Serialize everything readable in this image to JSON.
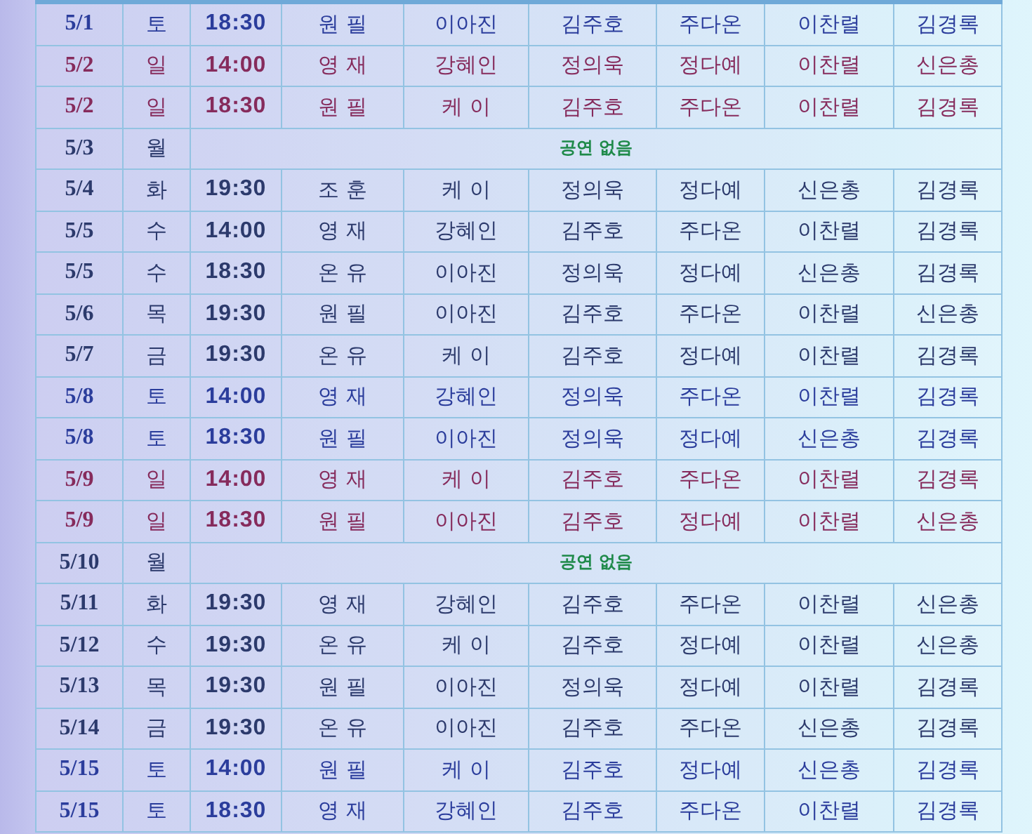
{
  "schedule": {
    "rows": [
      {
        "kind": "saturday",
        "date": "5/1",
        "day": "토",
        "time": "18:30",
        "cast": [
          "원 필",
          "이아진",
          "김주호",
          "주다온",
          "이찬렬",
          "김경록"
        ]
      },
      {
        "kind": "sunday",
        "date": "5/2",
        "day": "일",
        "time": "14:00",
        "cast": [
          "영 재",
          "강혜인",
          "정의욱",
          "정다예",
          "이찬렬",
          "신은총"
        ]
      },
      {
        "kind": "sunday",
        "date": "5/2",
        "day": "일",
        "time": "18:30",
        "cast": [
          "원 필",
          "케 이",
          "김주호",
          "주다온",
          "이찬렬",
          "김경록"
        ]
      },
      {
        "kind": "off",
        "date": "5/3",
        "day": "월",
        "note": "공연 없음"
      },
      {
        "kind": "weekday",
        "date": "5/4",
        "day": "화",
        "time": "19:30",
        "cast": [
          "조 훈",
          "케 이",
          "정의욱",
          "정다예",
          "신은총",
          "김경록"
        ]
      },
      {
        "kind": "weekday",
        "date": "5/5",
        "day": "수",
        "time": "14:00",
        "cast": [
          "영 재",
          "강혜인",
          "김주호",
          "주다온",
          "이찬렬",
          "김경록"
        ]
      },
      {
        "kind": "weekday",
        "date": "5/5",
        "day": "수",
        "time": "18:30",
        "cast": [
          "온 유",
          "이아진",
          "정의욱",
          "정다예",
          "신은총",
          "김경록"
        ]
      },
      {
        "kind": "weekday",
        "date": "5/6",
        "day": "목",
        "time": "19:30",
        "cast": [
          "원 필",
          "이아진",
          "김주호",
          "주다온",
          "이찬렬",
          "신은총"
        ]
      },
      {
        "kind": "weekday",
        "date": "5/7",
        "day": "금",
        "time": "19:30",
        "cast": [
          "온 유",
          "케 이",
          "김주호",
          "정다예",
          "이찬렬",
          "김경록"
        ]
      },
      {
        "kind": "saturday",
        "date": "5/8",
        "day": "토",
        "time": "14:00",
        "cast": [
          "영 재",
          "강혜인",
          "정의욱",
          "주다온",
          "이찬렬",
          "김경록"
        ]
      },
      {
        "kind": "saturday",
        "date": "5/8",
        "day": "토",
        "time": "18:30",
        "cast": [
          "원 필",
          "이아진",
          "정의욱",
          "정다예",
          "신은총",
          "김경록"
        ]
      },
      {
        "kind": "sunday",
        "date": "5/9",
        "day": "일",
        "time": "14:00",
        "cast": [
          "영 재",
          "케 이",
          "김주호",
          "주다온",
          "이찬렬",
          "김경록"
        ]
      },
      {
        "kind": "sunday",
        "date": "5/9",
        "day": "일",
        "time": "18:30",
        "cast": [
          "원 필",
          "이아진",
          "김주호",
          "정다예",
          "이찬렬",
          "신은총"
        ]
      },
      {
        "kind": "off",
        "date": "5/10",
        "day": "월",
        "note": "공연 없음"
      },
      {
        "kind": "weekday",
        "date": "5/11",
        "day": "화",
        "time": "19:30",
        "cast": [
          "영 재",
          "강혜인",
          "김주호",
          "주다온",
          "이찬렬",
          "신은총"
        ]
      },
      {
        "kind": "weekday",
        "date": "5/12",
        "day": "수",
        "time": "19:30",
        "cast": [
          "온 유",
          "케 이",
          "김주호",
          "정다예",
          "이찬렬",
          "신은총"
        ]
      },
      {
        "kind": "weekday",
        "date": "5/13",
        "day": "목",
        "time": "19:30",
        "cast": [
          "원 필",
          "이아진",
          "정의욱",
          "정다예",
          "이찬렬",
          "김경록"
        ]
      },
      {
        "kind": "weekday",
        "date": "5/14",
        "day": "금",
        "time": "19:30",
        "cast": [
          "온 유",
          "이아진",
          "김주호",
          "주다온",
          "신은총",
          "김경록"
        ]
      },
      {
        "kind": "saturday",
        "date": "5/15",
        "day": "토",
        "time": "14:00",
        "cast": [
          "원 필",
          "케 이",
          "김주호",
          "정다예",
          "신은총",
          "김경록"
        ]
      },
      {
        "kind": "saturday",
        "date": "5/15",
        "day": "토",
        "time": "18:30",
        "cast": [
          "영 재",
          "강혜인",
          "김주호",
          "주다온",
          "이찬렬",
          "김경록"
        ]
      }
    ]
  }
}
